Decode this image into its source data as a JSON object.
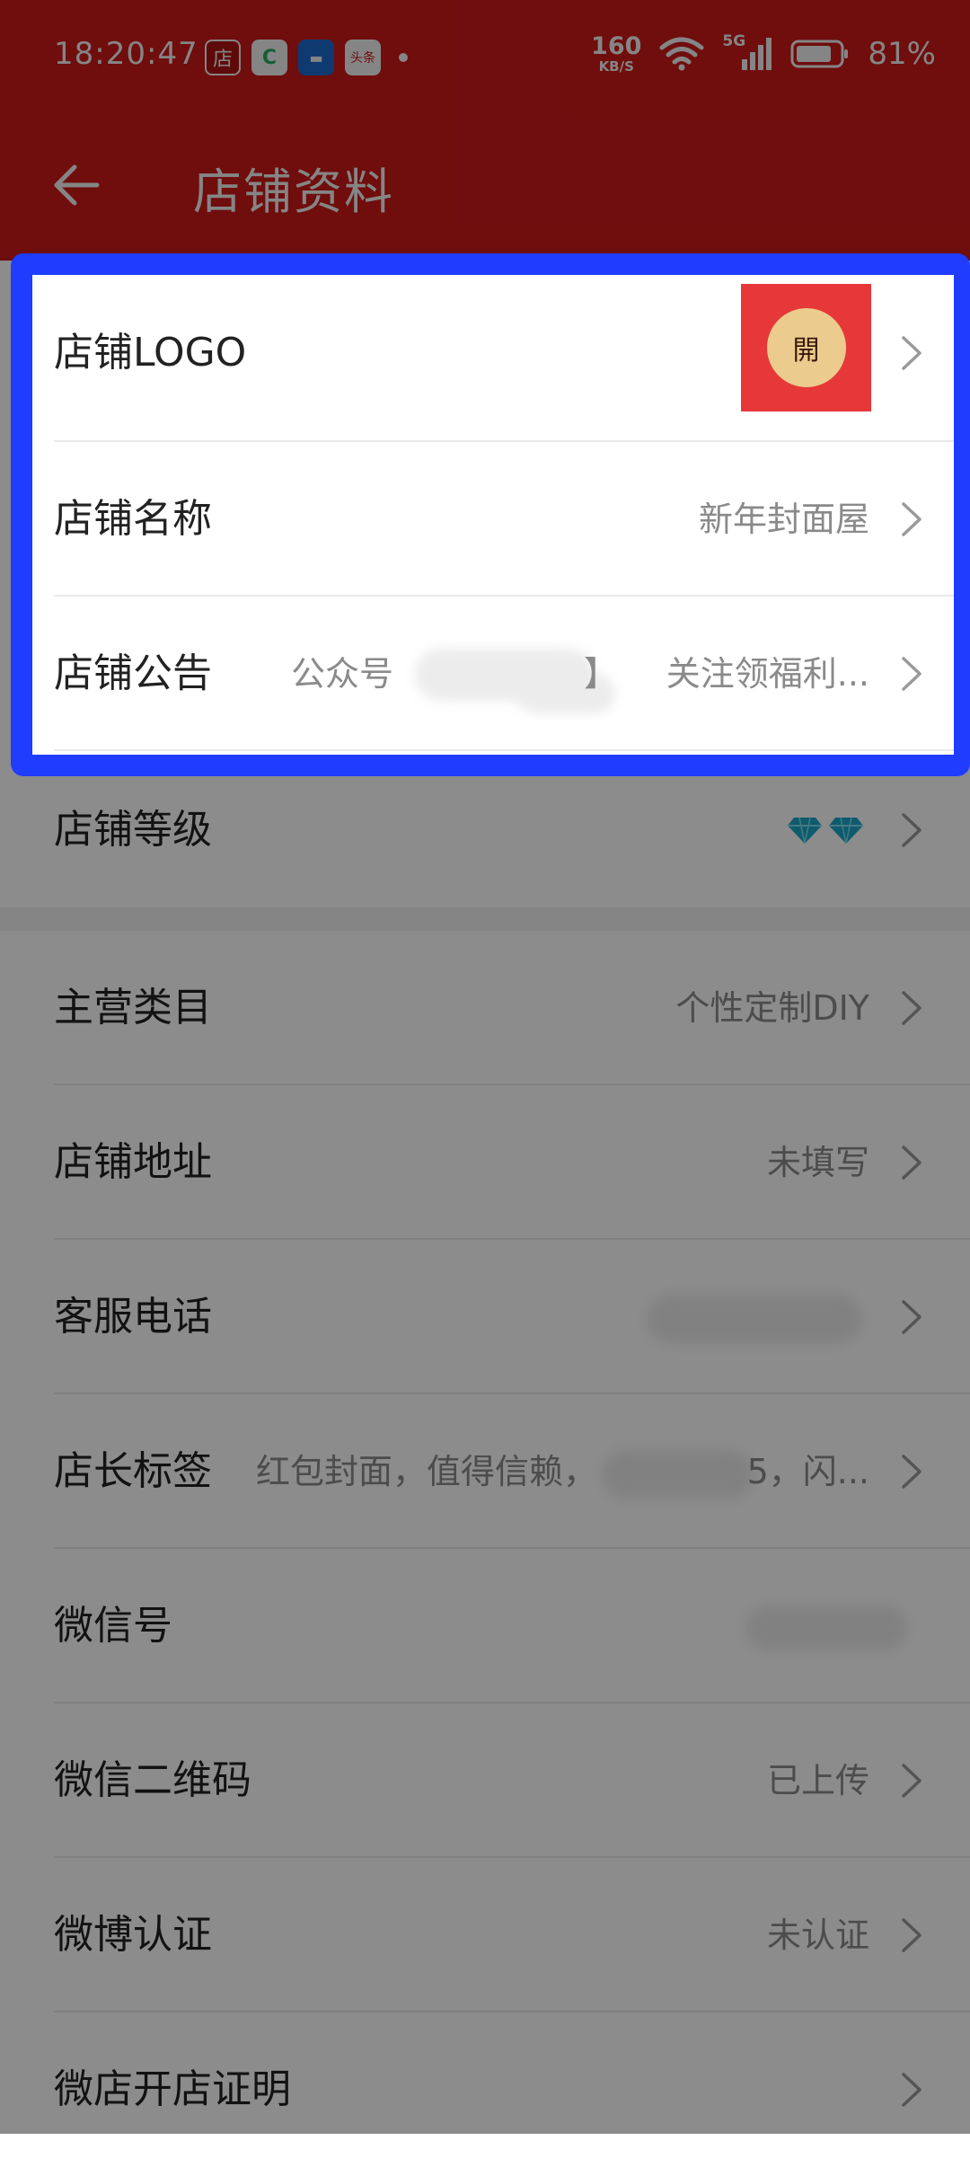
{
  "status_bar": {
    "time": "18:20:47",
    "notif_icons": [
      {
        "name": "store-app-icon",
        "glyph": "店",
        "bg": "#b71515"
      },
      {
        "name": "refresh-app-icon",
        "glyph": "C",
        "bg": "#ffffff",
        "color": "#28b464"
      },
      {
        "name": "message-app-icon",
        "glyph": "▬",
        "bg": "#1e6fd9"
      },
      {
        "name": "news-app-icon",
        "glyph": "头条",
        "bg": "#ffffff",
        "color": "#d6191a"
      }
    ],
    "net_speed_value": "160",
    "net_speed_unit": "KB/S",
    "network_type": "5G",
    "battery": "81%"
  },
  "header": {
    "title": "店铺资料",
    "color": "#d6191a"
  },
  "rows": [
    {
      "key": "logo",
      "label": "店铺LOGO",
      "value": "",
      "logo_glyph": "開"
    },
    {
      "key": "name",
      "label": "店铺名称",
      "value": "新年封面屋"
    },
    {
      "key": "notice",
      "label": "店铺公告",
      "value_prefix": "公众号",
      "value": "关注领福利...",
      "value_bracket": "】"
    },
    {
      "key": "level",
      "label": "店铺等级",
      "value": ""
    },
    {
      "key": "category",
      "label": "主营类目",
      "value": "个性定制DIY"
    },
    {
      "key": "address",
      "label": "店铺地址",
      "value": "未填写"
    },
    {
      "key": "phone",
      "label": "客服电话",
      "value": ""
    },
    {
      "key": "tags",
      "label": "店长标签",
      "value_prefix": "红包封面，值得信赖，",
      "value": "5，闪..."
    },
    {
      "key": "wechat",
      "label": "微信号",
      "value": ""
    },
    {
      "key": "wechat_qr",
      "label": "微信二维码",
      "value": "已上传"
    },
    {
      "key": "weibo",
      "label": "微博认证",
      "value": "未认证"
    },
    {
      "key": "certificate",
      "label": "微店开店证明",
      "value": ""
    }
  ],
  "colors": {
    "highlight_border": "#1f3cff",
    "diamond": "#1aa6c8"
  }
}
